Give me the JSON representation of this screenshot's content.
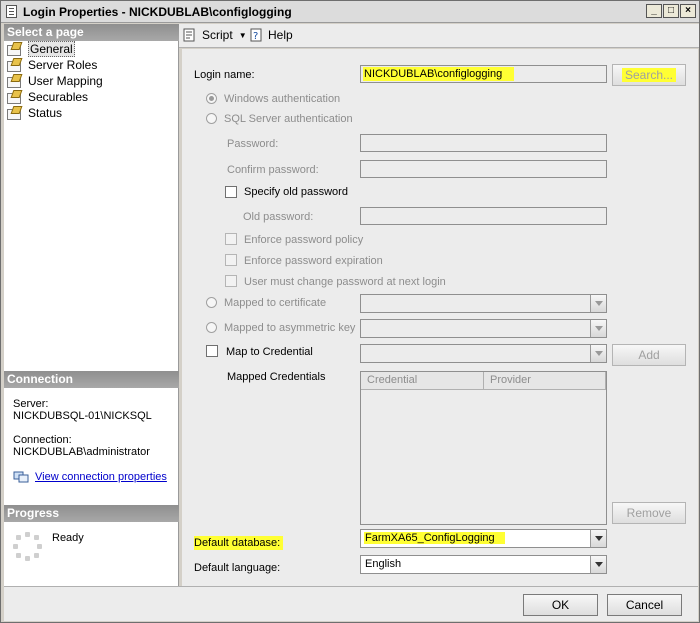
{
  "window": {
    "title": "Login Properties - NICKDUBLAB\\configlogging"
  },
  "left_pane": {
    "select_page_header": "Select a page",
    "pages": [
      {
        "label": "General",
        "selected": true
      },
      {
        "label": "Server Roles"
      },
      {
        "label": "User Mapping"
      },
      {
        "label": "Securables"
      },
      {
        "label": "Status"
      }
    ],
    "connection": {
      "header": "Connection",
      "server_label": "Server:",
      "server_value": "NICKDUBSQL-01\\NICKSQL",
      "connection_label": "Connection:",
      "connection_value": "NICKDUBLAB\\administrator",
      "view_link": "View connection properties"
    },
    "progress": {
      "header": "Progress",
      "status": "Ready"
    }
  },
  "toolbar": {
    "script_label": "Script",
    "help_label": "Help"
  },
  "general": {
    "login_name_label": "Login name:",
    "login_name_value": "NICKDUBLAB\\configlogging",
    "search_button": "Search...",
    "windows_auth": "Windows authentication",
    "sql_auth": "SQL Server authentication",
    "password_label": "Password:",
    "confirm_password_label": "Confirm password:",
    "specify_old_password": "Specify old password",
    "old_password_label": "Old password:",
    "enforce_policy": "Enforce password policy",
    "enforce_expiration": "Enforce password expiration",
    "must_change": "User must change password at next login",
    "mapped_cert": "Mapped to certificate",
    "mapped_asym": "Mapped to asymmetric key",
    "map_credential": "Map to Credential",
    "add_button": "Add",
    "mapped_credentials_label": "Mapped Credentials",
    "grid_headers": [
      "Credential",
      "Provider"
    ],
    "remove_button": "Remove",
    "default_database_label": "Default database:",
    "default_database_value": "FarmXA65_ConfigLogging",
    "default_language_label": "Default language:",
    "default_language_value": "English"
  },
  "footer": {
    "ok": "OK",
    "cancel": "Cancel"
  },
  "colors": {
    "highlight": "#ffff33"
  }
}
